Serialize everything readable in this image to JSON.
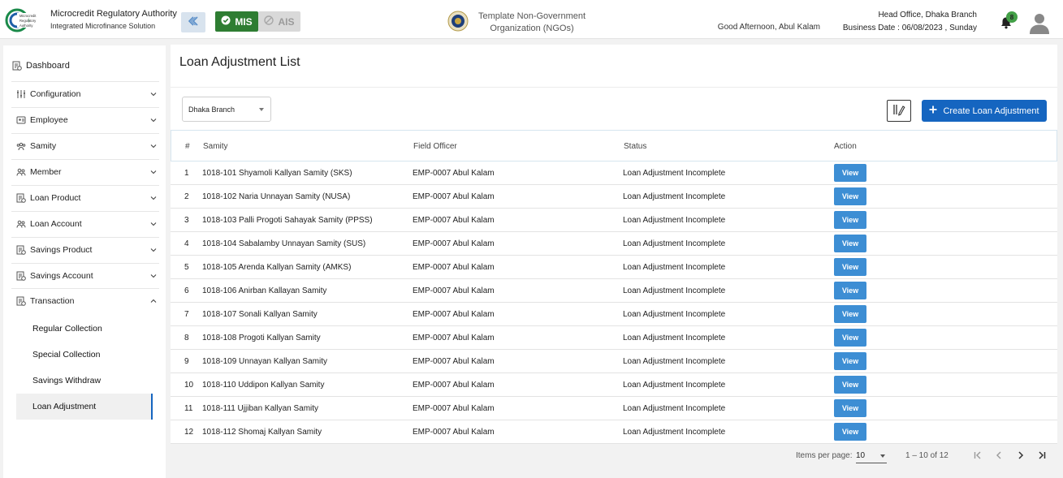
{
  "header": {
    "brand_title": "Microcredit Regulatory Authority",
    "brand_subtitle": "Integrated Microfinance Solution",
    "logo_text": "Microcredit Regulatory Authority",
    "mis_label": "MIS",
    "ais_label": "AIS",
    "org_name": "Template Non-Government Organization (NGOs)",
    "greeting": "Good Afternoon, Abul Kalam",
    "branch": "Head Office, Dhaka Branch",
    "business_date": "Business Date : 06/08/2023 , Sunday",
    "notification_count": "8",
    "colors": {
      "mis": "#2e7d32",
      "primary": "#1565c0",
      "view": "#3d8ed4"
    }
  },
  "sidebar": {
    "dashboard": "Dashboard",
    "items": [
      {
        "label": "Configuration",
        "icon": "sliders-icon",
        "expanded": false
      },
      {
        "label": "Employee",
        "icon": "users-icon",
        "expanded": false
      },
      {
        "label": "Samity",
        "icon": "group-icon",
        "expanded": false
      },
      {
        "label": "Member",
        "icon": "members-icon",
        "expanded": false
      },
      {
        "label": "Loan Product",
        "icon": "document-icon",
        "expanded": false
      },
      {
        "label": "Loan Account",
        "icon": "members-icon",
        "expanded": false
      },
      {
        "label": "Savings Product",
        "icon": "document-icon",
        "expanded": false
      },
      {
        "label": "Savings Account",
        "icon": "document-icon",
        "expanded": false
      },
      {
        "label": "Transaction",
        "icon": "document-icon",
        "expanded": true
      }
    ],
    "sub_items": [
      "Regular Collection",
      "Special Collection",
      "Savings Withdraw",
      "Loan Adjustment"
    ],
    "active_sub": "Loan Adjustment"
  },
  "main": {
    "title": "Loan Adjustment List",
    "branch_select": "Dhaka Branch",
    "create_label": "Create Loan Adjustment",
    "columns": [
      "#",
      "Samity",
      "Field Officer",
      "Status",
      "Action"
    ],
    "rows": [
      {
        "num": "1",
        "samity": "1018-101 Shyamoli Kallyan Samity (SKS)",
        "officer": "EMP-0007 Abul Kalam",
        "status": "Loan Adjustment Incomplete",
        "action": "View"
      },
      {
        "num": "2",
        "samity": "1018-102 Naria Unnayan Samity (NUSA)",
        "officer": "EMP-0007 Abul Kalam",
        "status": "Loan Adjustment Incomplete",
        "action": "View"
      },
      {
        "num": "3",
        "samity": "1018-103 Palli Progoti Sahayak Samity (PPSS)",
        "officer": "EMP-0007 Abul Kalam",
        "status": "Loan Adjustment Incomplete",
        "action": "View"
      },
      {
        "num": "4",
        "samity": "1018-104 Sabalamby Unnayan Samity (SUS)",
        "officer": "EMP-0007 Abul Kalam",
        "status": "Loan Adjustment Incomplete",
        "action": "View"
      },
      {
        "num": "5",
        "samity": "1018-105 Arenda Kallyan Samity (AMKS)",
        "officer": "EMP-0007 Abul Kalam",
        "status": "Loan Adjustment Incomplete",
        "action": "View"
      },
      {
        "num": "6",
        "samity": "1018-106 Anirban Kallayan Samity",
        "officer": "EMP-0007 Abul Kalam",
        "status": "Loan Adjustment Incomplete",
        "action": "View"
      },
      {
        "num": "7",
        "samity": "1018-107 Sonali Kallyan Samity",
        "officer": "EMP-0007 Abul Kalam",
        "status": "Loan Adjustment Incomplete",
        "action": "View"
      },
      {
        "num": "8",
        "samity": "1018-108 Progoti Kallyan Samity",
        "officer": "EMP-0007 Abul Kalam",
        "status": "Loan Adjustment Incomplete",
        "action": "View"
      },
      {
        "num": "9",
        "samity": "1018-109 Unnayan Kallyan Samity",
        "officer": "EMP-0007 Abul Kalam",
        "status": "Loan Adjustment Incomplete",
        "action": "View"
      },
      {
        "num": "10",
        "samity": "1018-110 Uddipon Kallyan Samity",
        "officer": "EMP-0007 Abul Kalam",
        "status": "Loan Adjustment Incomplete",
        "action": "View"
      },
      {
        "num": "11",
        "samity": "1018-111 Ujjiban Kallyan Samity",
        "officer": "EMP-0007 Abul Kalam",
        "status": "Loan Adjustment Incomplete",
        "action": "View"
      },
      {
        "num": "12",
        "samity": "1018-112 Shomaj Kallyan Samity",
        "officer": "EMP-0007 Abul Kalam",
        "status": "Loan Adjustment Incomplete",
        "action": "View"
      }
    ]
  },
  "pagination": {
    "items_per_page_label": "Items per page:",
    "items_per_page": "10",
    "range": "1 – 10 of 12"
  }
}
